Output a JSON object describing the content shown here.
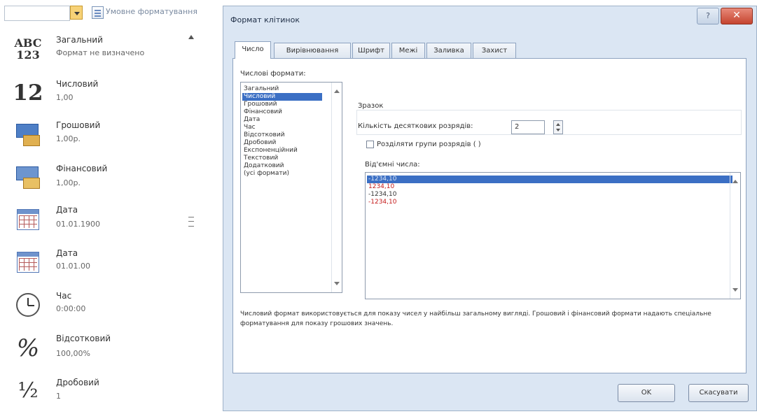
{
  "gallery": {
    "cond_format_label": "Умовне форматування",
    "items": [
      {
        "icon": "abc-123-icon",
        "icon_text": "ABC\n123",
        "name": "Загальний",
        "sample": "Формат не визначено"
      },
      {
        "icon": "number-12-icon",
        "icon_text": "12",
        "name": "Числовий",
        "sample": "1,00"
      },
      {
        "icon": "currency-icon",
        "name": "Грошовий",
        "sample": "1,00р."
      },
      {
        "icon": "accounting-icon",
        "name": "Фінансовий",
        "sample": "1,00р."
      },
      {
        "icon": "calendar-icon",
        "name": "Дата",
        "sample": "01.01.1900"
      },
      {
        "icon": "calendar-icon",
        "name": "Дата",
        "sample": "01.01.00"
      },
      {
        "icon": "clock-icon",
        "name": "Час",
        "sample": "0:00:00"
      },
      {
        "icon": "percent-icon",
        "icon_text": "%",
        "name": "Відсотковий",
        "sample": "100,00%"
      },
      {
        "icon": "fraction-icon",
        "icon_text": "½",
        "name": "Дробовий",
        "sample": "1"
      }
    ]
  },
  "dialog": {
    "title": "Формат клітинок",
    "help_glyph": "?",
    "close_glyph": "✕",
    "tabs": [
      "Число",
      "Вирівнювання",
      "Шрифт",
      "Межі",
      "Заливка",
      "Захист"
    ],
    "active_tab": "Число",
    "categories_label": "Числові формати:",
    "categories": [
      "Загальний",
      "Числовий",
      "Грошовий",
      "Фінансовий",
      "Дата",
      "Час",
      "Відсотковий",
      "Дробовий",
      "Експоненційний",
      "Текстовий",
      "Додатковий",
      "(усі формати)"
    ],
    "selected_category": "Числовий",
    "sample_label": "Зразок",
    "decimals_label": "Кількість десяткових розрядів:",
    "decimals_value": "2",
    "separator_label": "Розділяти групи розрядів ( )",
    "separator_checked": false,
    "negative_label": "Від'ємні числа:",
    "negative_numbers": [
      "-1234,10",
      "1234,10",
      "-1234,10",
      "-1234,10"
    ],
    "description": "Числовий формат використовується для показу чисел у найбільш загальному вигляді. Грошовий і фінансовий формати надають спеціальне форматування для показу грошових значень.",
    "ok_label": "OK",
    "cancel_label": "Скасувати"
  }
}
